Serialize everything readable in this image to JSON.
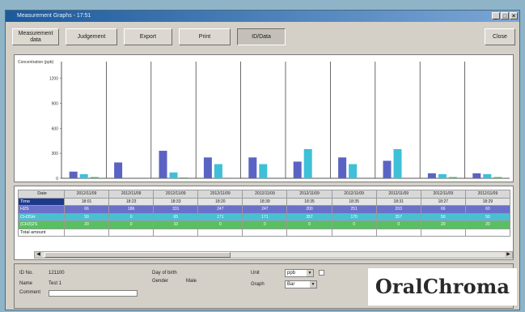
{
  "window": {
    "title": "Measurement Graphs - 17:51"
  },
  "toolbar": {
    "measurement_data": "Measurement data",
    "judgement": "Judgement",
    "export": "Export",
    "print": "Print",
    "id_data": "ID/Data",
    "close": "Close"
  },
  "chart_data": {
    "type": "bar",
    "ylabel": "Concentration (ppb)",
    "y_ticks": [
      "1200",
      "900",
      "600",
      "300",
      "0"
    ],
    "ylim": [
      0,
      1400
    ],
    "categories": [
      "2012/11/09 18:01",
      "2012/11/09 18:23",
      "2012/11/09 18:33",
      "2012/11/09 18:20",
      "2012/11/09 18:39",
      "2012/11/09 18:35",
      "2012/11/09 18:35",
      "2012/11/09 18:31",
      "2012/11/09 18:27",
      "2012/11/09 18:29"
    ],
    "series": [
      {
        "name": "H2S",
        "color": "#5a63c4",
        "values": [
          80,
          190,
          330,
          250,
          250,
          200,
          250,
          210,
          60,
          60
        ]
      },
      {
        "name": "CH3SH",
        "color": "#3ec0d8",
        "values": [
          50,
          0,
          70,
          170,
          170,
          350,
          170,
          350,
          50,
          50
        ]
      },
      {
        "name": "(CH3)2S",
        "color": "#52b85a",
        "values": [
          15,
          0,
          10,
          0,
          0,
          0,
          0,
          0,
          15,
          15
        ]
      }
    ],
    "grid": true
  },
  "table": {
    "date_label": "Date",
    "time_label": "Time",
    "h2s_label": "H2S",
    "ch3sh_label": "CH3SH",
    "ch32s_label": "(CH3)2S",
    "total_label": "Total amount",
    "dates": [
      "2012/11/09",
      "2012/11/09",
      "2012/11/09",
      "2012/11/09",
      "2012/11/09",
      "2012/11/09",
      "2012/11/09",
      "2012/11/09",
      "2012/11/09",
      "2012/11/09"
    ],
    "times": [
      "18:01",
      "18:23",
      "18:33",
      "18:20",
      "18:39",
      "18:35",
      "18:35",
      "18:31",
      "18:27",
      "18:29"
    ],
    "h2s": [
      "66",
      "186",
      "331",
      "247",
      "247",
      "200",
      "251",
      "203",
      "66",
      "60"
    ],
    "ch3sh": [
      "50",
      "0",
      "65",
      "171",
      "171",
      "357",
      "170",
      "357",
      "50",
      "50"
    ],
    "ch32s": [
      "20",
      "0",
      "10",
      "0",
      "0",
      "0",
      "0",
      "0",
      "20",
      "20"
    ],
    "total": [
      "",
      "",
      "",
      "",
      "",
      "",
      "",
      "",
      "",
      ""
    ]
  },
  "info": {
    "id_label": "ID No.",
    "id_value": "121100",
    "name_label": "Name",
    "name_value": "Test 1",
    "comment_label": "Comment",
    "dob_label": "Day of birth",
    "gender_label": "Gender",
    "gender_value": "Male",
    "unit_label": "Unit",
    "unit_value": "ppb",
    "graph_label": "Graph",
    "graph_value": "Bar"
  },
  "logo": {
    "text": "OralChroma"
  }
}
